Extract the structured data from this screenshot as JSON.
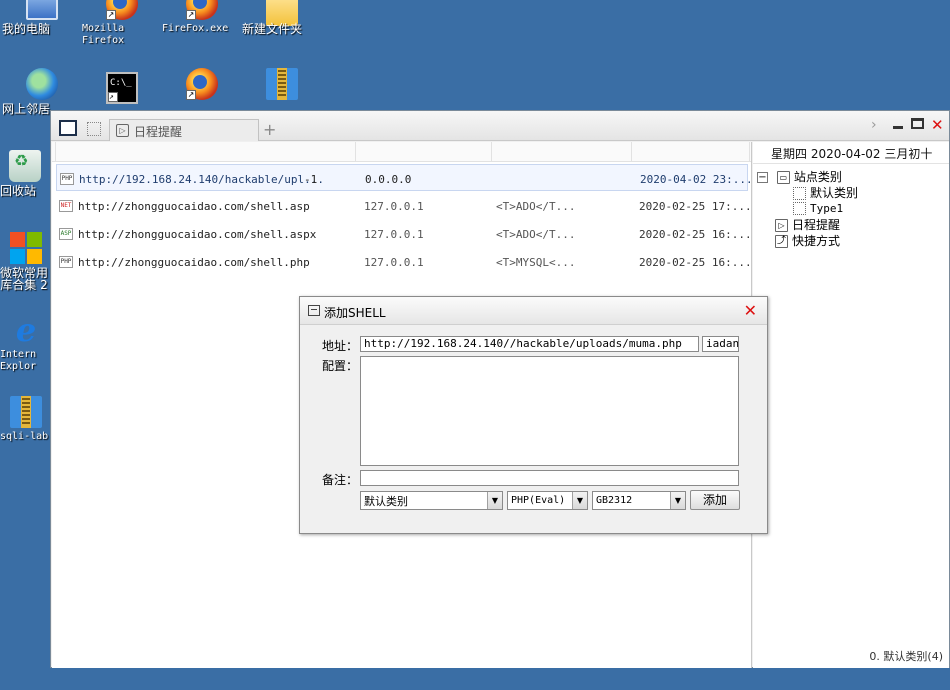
{
  "desktop": {
    "icons": [
      {
        "label": "我的电脑",
        "icon": "computer-icon"
      },
      {
        "label": "Mozilla\nFirefox",
        "icon": "firefox-icon"
      },
      {
        "label": "FireFox.exe",
        "icon": "firefox-icon"
      },
      {
        "label": "新建文件夹",
        "icon": "folder-icon"
      },
      {
        "label": "网上邻居",
        "icon": "network-icon"
      },
      {
        "label": "",
        "icon": "cmd-icon"
      },
      {
        "label": "",
        "icon": "firefox-icon"
      },
      {
        "label": "",
        "icon": "archive-icon"
      },
      {
        "label": "回收站",
        "icon": "recycle-bin-icon"
      },
      {
        "label": "微软常用\n库合集 2",
        "icon": "windows-logo-icon"
      },
      {
        "label": "Intern\nExplor",
        "icon": "internet-explorer-icon"
      },
      {
        "label": "sqli-lab",
        "icon": "archive-icon"
      }
    ]
  },
  "app": {
    "tab_label": "日程提醒",
    "date_bar": "星期四 2020-04-02 三月初十",
    "shells": [
      {
        "type": "PHP",
        "url": "http://192.168.24.140/hackable/upl...",
        "extra": "-1",
        "ip": "0.0.0.0",
        "note": "",
        "time": "2020-04-02 23:..."
      },
      {
        "type": "NET",
        "url": "http://zhongguocaidao.com/shell.asp",
        "extra": "",
        "ip": "127.0.0.1",
        "note": "<T>ADO</T...",
        "time": "2020-02-25 17:..."
      },
      {
        "type": "ASP",
        "url": "http://zhongguocaidao.com/shell.aspx",
        "extra": "",
        "ip": "127.0.0.1",
        "note": "<T>ADO</T...",
        "time": "2020-02-25 16:..."
      },
      {
        "type": "PHP",
        "url": "http://zhongguocaidao.com/shell.php",
        "extra": "",
        "ip": "127.0.0.1",
        "note": "<T>MYSQL<...",
        "time": "2020-02-25 16:..."
      }
    ],
    "tree": {
      "root": "站点类别",
      "children": [
        "默认类别",
        "Type1"
      ],
      "items": [
        "日程提醒",
        "快捷方式"
      ]
    },
    "status": "0. 默认类别(4)"
  },
  "dialog": {
    "title": "添加SHELL",
    "address_label": "地址：",
    "address_value": "http://192.168.24.140//hackable/uploads/muma.php",
    "password_value": "iadan",
    "config_label": "配置：",
    "config_value": "",
    "remark_label": "备注：",
    "remark_value": "",
    "category_value": "默认类别",
    "script_type_value": "PHP(Eval)",
    "encoding_value": "GB2312",
    "add_button": "添加"
  },
  "colors": {
    "desktop": "#3a6ea5",
    "close_red": "#dd1111"
  }
}
